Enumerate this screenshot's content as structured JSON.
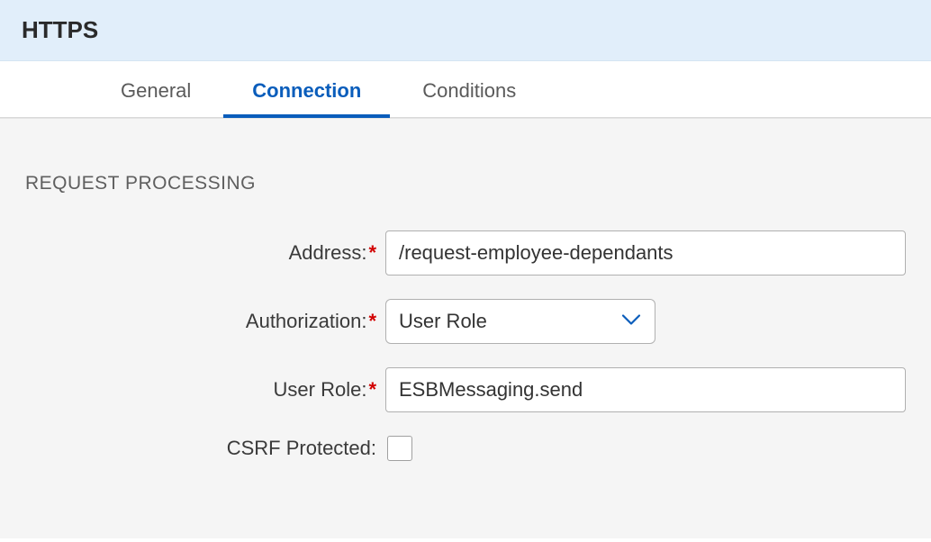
{
  "header": {
    "title": "HTTPS"
  },
  "tabs": [
    {
      "label": "General",
      "active": false
    },
    {
      "label": "Connection",
      "active": true
    },
    {
      "label": "Conditions",
      "active": false
    }
  ],
  "section": {
    "title": "REQUEST PROCESSING"
  },
  "fields": {
    "address": {
      "label": "Address:",
      "value": "/request-employee-dependants",
      "required": true
    },
    "authorization": {
      "label": "Authorization:",
      "value": "User Role",
      "required": true
    },
    "userRole": {
      "label": "User Role:",
      "value": "ESBMessaging.send",
      "required": true
    },
    "csrf": {
      "label": "CSRF Protected:",
      "checked": false,
      "required": false
    }
  }
}
